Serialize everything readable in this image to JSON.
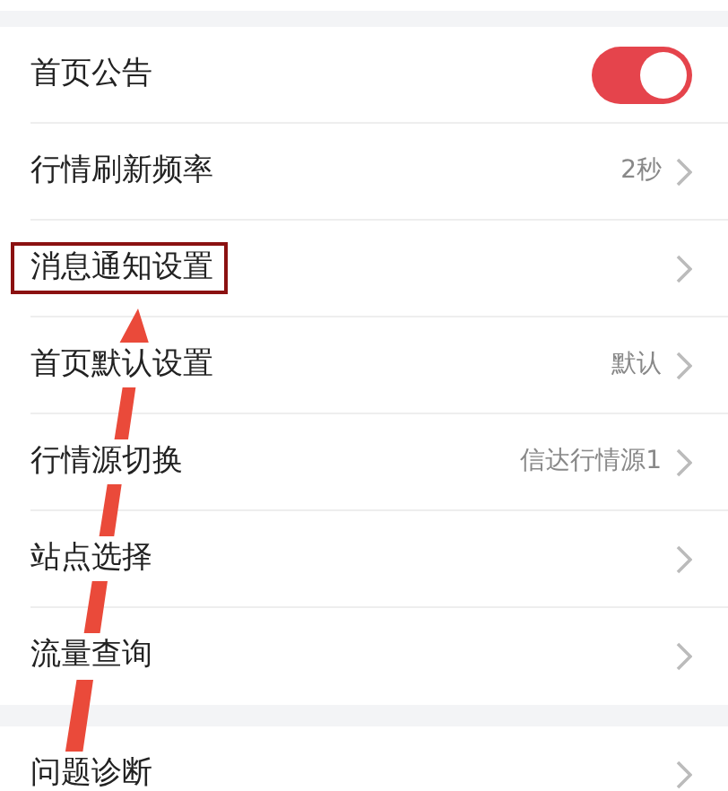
{
  "sections": [
    {
      "items": [
        {
          "kind": "toggle",
          "label": "首页公告",
          "on": true,
          "highlighted": false
        },
        {
          "kind": "link",
          "label": "行情刷新频率",
          "value": "2秒",
          "highlighted": false
        },
        {
          "kind": "link",
          "label": "消息通知设置",
          "highlighted": true
        },
        {
          "kind": "link",
          "label": "首页默认设置",
          "value": "默认",
          "highlighted": false
        },
        {
          "kind": "link",
          "label": "行情源切换",
          "value": "信达行情源1",
          "highlighted": false
        },
        {
          "kind": "link",
          "label": "站点选择",
          "highlighted": false
        },
        {
          "kind": "link",
          "label": "流量查询",
          "highlighted": false
        }
      ]
    },
    {
      "items": [
        {
          "kind": "link",
          "label": "问题诊断",
          "highlighted": false
        }
      ]
    }
  ]
}
